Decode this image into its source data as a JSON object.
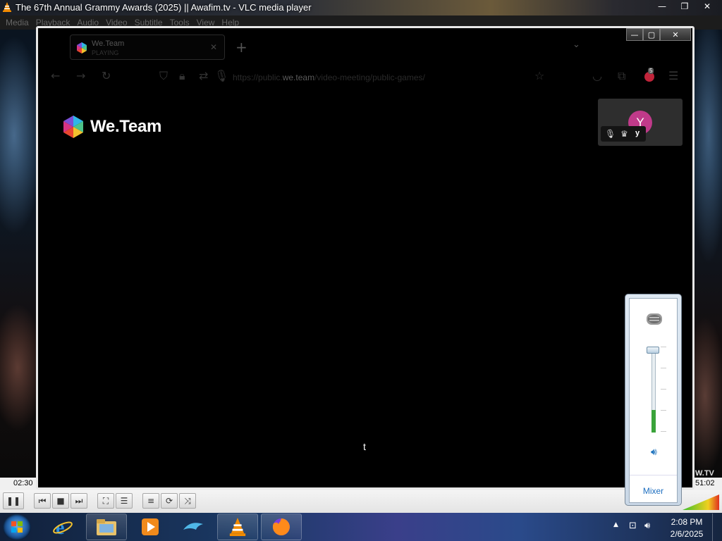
{
  "vlc": {
    "title": "The 67th Annual Grammy Awards (2025) || Awafim.tv - VLC media player",
    "menu": [
      "Media",
      "Playback",
      "Audio",
      "Video",
      "Subtitle",
      "Tools",
      "View",
      "Help"
    ],
    "time_elapsed": "02:30",
    "time_total": "51:02",
    "watermark": "W.TV"
  },
  "browser": {
    "tab_title": "We.Team",
    "tab_subtitle": "PLAYING",
    "url_prefix": "https://",
    "url_sub": "public.",
    "url_domain": "we.team",
    "url_path": "/video-meeting/public-games/",
    "extension_badge": "5"
  },
  "app": {
    "logo_text": "We.Team",
    "participant_initial": "Y",
    "participant_name": "y",
    "center_text": "t"
  },
  "volume_popup": {
    "level_percent": 26,
    "mixer_label": "Mixer"
  },
  "taskbar": {
    "time": "2:08 PM",
    "date": "2/6/2025"
  }
}
